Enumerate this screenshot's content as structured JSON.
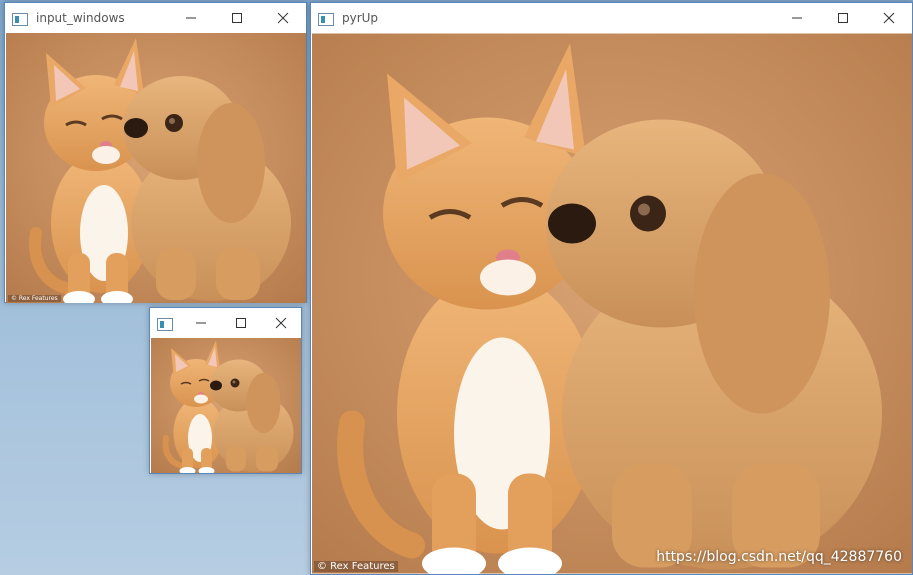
{
  "windows": {
    "input": {
      "title": "input_windows"
    },
    "pyrup": {
      "title": "pyrUp"
    },
    "small": {
      "title": ""
    }
  },
  "image": {
    "subject": "orange kitten and puppy kissing",
    "credit": "© Rex Features"
  },
  "watermark": "https://blog.csdn.net/qq_42887760",
  "icons": {
    "app": "opencv-window-icon",
    "minimize": "minimize-icon",
    "maximize": "maximize-icon",
    "close": "close-icon"
  },
  "colors": {
    "background": "#c98f5f",
    "desktop": "#9dbcd9",
    "window_border": "#5a86b8",
    "kitten": "#e6a462",
    "puppy": "#d9a46a"
  }
}
